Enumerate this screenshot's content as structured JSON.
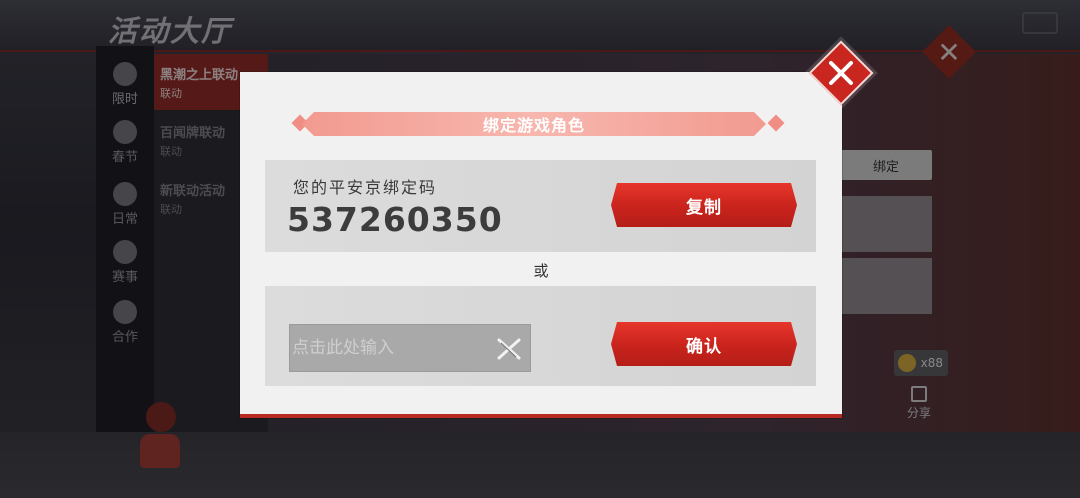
{
  "background": {
    "title": "活动大厅",
    "sidebar": [
      {
        "label": "限时",
        "icon": "clock-icon"
      },
      {
        "label": "春节",
        "icon": "spring-festival-icon"
      },
      {
        "label": "日常",
        "icon": "gift-icon"
      },
      {
        "label": "赛事",
        "icon": "trophy-icon"
      },
      {
        "label": "合作",
        "icon": "handshake-icon"
      }
    ],
    "events": [
      {
        "title": "黑潮之上联动",
        "subtitle": "联动"
      },
      {
        "title": "百闻牌联动",
        "subtitle": "联动"
      },
      {
        "title": "新联动活动",
        "subtitle": "联动"
      }
    ],
    "bind_button": "绑定",
    "coin_count": "x88",
    "share_label": "分享"
  },
  "dialog": {
    "title": "绑定游戏角色",
    "code_label": "您的平安京绑定码",
    "code_value": "537260350",
    "copy_button": "复制",
    "or_text": "或",
    "input_placeholder": "点击此处输入",
    "confirm_button": "确认"
  },
  "colors": {
    "accent_red": "#c8261f",
    "ribbon_pink": "#f29a90",
    "panel_gray": "#d8d8d8"
  }
}
